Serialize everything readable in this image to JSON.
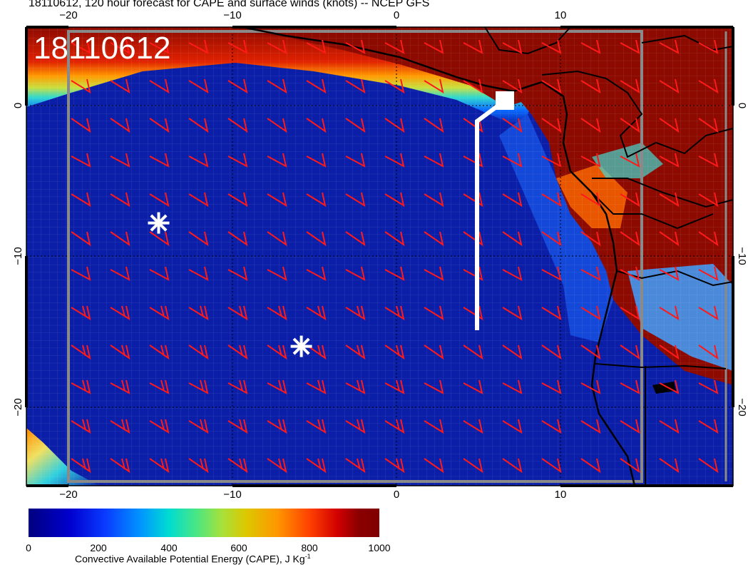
{
  "title": "18110612, 120 hour forecast for CAPE and surface winds (knots) -- NCEP GFS",
  "date_stamp": "18110612",
  "map": {
    "lon_ticks": [
      "−20",
      "−10",
      "0",
      "10"
    ],
    "lat_ticks": [
      "0",
      "−10",
      "−20"
    ],
    "feature_colors": {
      "coast": "#000000",
      "wind_barbs": "#ff1a1a",
      "track": "#ffffff",
      "ocean": "#0a1ea8",
      "high_cape": "#8c0a00"
    },
    "markers": [
      {
        "name": "asterisk",
        "lon": -14.5,
        "lat": -7.8
      },
      {
        "name": "asterisk",
        "lon": -5.8,
        "lat": -16.0
      }
    ],
    "track_line": {
      "points_lonlat": [
        [
          5,
          -15
        ],
        [
          5,
          -1
        ],
        [
          6.2,
          0
        ],
        [
          6.2,
          0.3
        ]
      ],
      "end_marker": "square"
    }
  },
  "colorbar": {
    "ticks": [
      "0",
      "200",
      "400",
      "600",
      "800",
      "1000"
    ],
    "label": "Convective Available Potential Energy (CAPE), J Kg",
    "label_superscript": "-1",
    "range": [
      0,
      1000
    ]
  }
}
